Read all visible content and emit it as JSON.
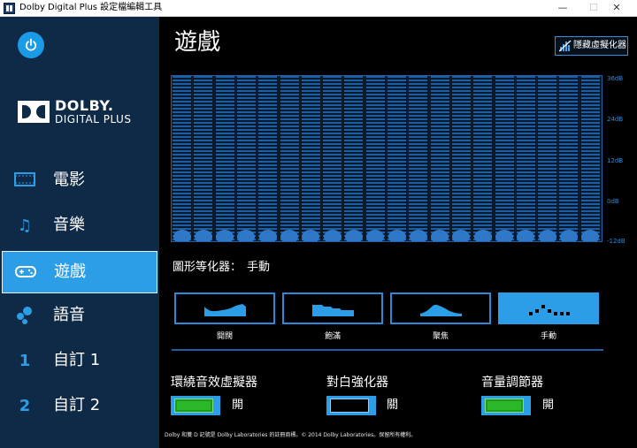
{
  "window": {
    "title": "Dolby Digital Plus 設定檔編輯工具",
    "min_glyph": "—",
    "max_glyph": "☐",
    "close_glyph": "✕"
  },
  "sidebar": {
    "logo": {
      "brand": "DOLBY.",
      "sub": "DIGITAL PLUS"
    },
    "items": [
      {
        "label": "電影",
        "icon": "film-icon",
        "glyph": "▭"
      },
      {
        "label": "音樂",
        "icon": "music-note-icon",
        "glyph": "♫"
      },
      {
        "label": "遊戲",
        "icon": "gamepad-icon",
        "glyph": "⊕",
        "active": true
      },
      {
        "label": "語音",
        "icon": "voice-bubbles-icon",
        "glyph": "●"
      },
      {
        "label": "自訂 1",
        "icon": "number-1-icon",
        "glyph": "1"
      },
      {
        "label": "自訂 2",
        "icon": "number-2-icon",
        "glyph": "2"
      }
    ]
  },
  "main": {
    "title": "遊戲",
    "hide_visualizer_label": "隱藏虛擬化器",
    "visualizer": {
      "db_labels": [
        "36dB",
        "24dB",
        "12dB",
        "0dB",
        "-12dB"
      ],
      "band_count": 20
    },
    "graphic_eq": {
      "label": "圖形等化器：",
      "value": "手動"
    },
    "presets": [
      {
        "label": "開闊",
        "icon": "open-curve-icon"
      },
      {
        "label": "飽滿",
        "icon": "rich-curve-icon"
      },
      {
        "label": "聚焦",
        "icon": "focused-curve-icon"
      },
      {
        "label": "手動",
        "icon": "manual-dots-icon",
        "selected": true
      }
    ],
    "toggles": [
      {
        "title": "環繞音效虛擬器",
        "state": "開",
        "on": true
      },
      {
        "title": "對白強化器",
        "state": "關",
        "on": false
      },
      {
        "title": "音量調節器",
        "state": "開",
        "on": true
      }
    ],
    "footer": "Dolby 和雙 D 記號是 Dolby Laboratories 的註冊商標。© 2014 Dolby Laboratories。保留所有權利。"
  },
  "colors": {
    "sidebar_bg": "#0f2a47",
    "accent": "#2c9ee8",
    "toggle_on": "#2ab82a",
    "visualizer_bars": "#1d5ea8"
  }
}
